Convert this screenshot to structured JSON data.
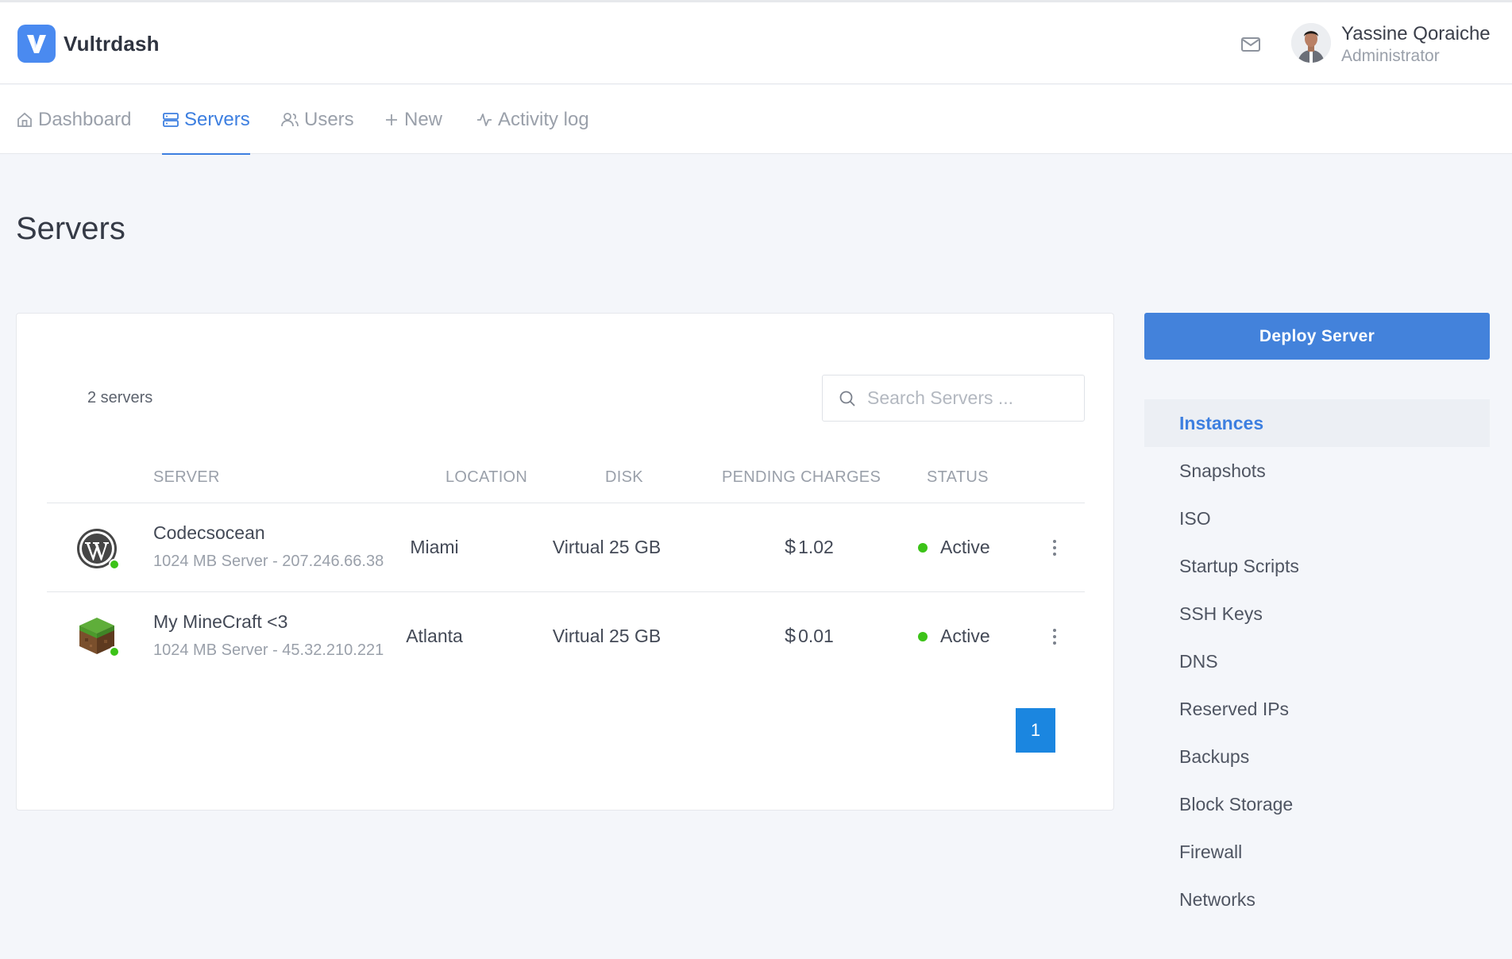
{
  "app": {
    "name": "Vultrdash"
  },
  "user": {
    "name": "Yassine Qoraiche",
    "role": "Administrator"
  },
  "nav": [
    {
      "label": "Dashboard",
      "icon": "home-icon",
      "active": false
    },
    {
      "label": "Servers",
      "icon": "server-icon",
      "active": true
    },
    {
      "label": "Users",
      "icon": "users-icon",
      "active": false
    },
    {
      "label": "New",
      "icon": "plus-icon",
      "active": false
    },
    {
      "label": "Activity log",
      "icon": "activity-icon",
      "active": false
    }
  ],
  "page": {
    "title": "Servers"
  },
  "servers": {
    "count_label": "2 servers",
    "search_placeholder": "Search Servers ...",
    "columns": [
      "SERVER",
      "LOCATION",
      "DISK",
      "PENDING CHARGES",
      "STATUS"
    ],
    "rows": [
      {
        "name": "Codecsocean",
        "details": "1024 MB Server - 207.246.66.38",
        "icon": "wordpress-icon",
        "location": "Miami",
        "disk": "Virtual 25 GB",
        "currency": "$",
        "charges": "1.02",
        "status": "Active"
      },
      {
        "name": "My MineCraft <3",
        "details": "1024 MB Server - 45.32.210.221",
        "icon": "minecraft-icon",
        "location": "Atlanta",
        "disk": "Virtual 25 GB",
        "currency": "$",
        "charges": "0.01",
        "status": "Active"
      }
    ],
    "pagination": {
      "current": "1"
    }
  },
  "sidebar": {
    "deploy_label": "Deploy Server",
    "items": [
      {
        "label": "Instances",
        "active": true
      },
      {
        "label": "Snapshots"
      },
      {
        "label": "ISO"
      },
      {
        "label": "Startup Scripts"
      },
      {
        "label": "SSH Keys"
      },
      {
        "label": "DNS"
      },
      {
        "label": "Reserved IPs"
      },
      {
        "label": "Backups"
      },
      {
        "label": "Block Storage"
      },
      {
        "label": "Firewall"
      },
      {
        "label": "Networks"
      }
    ]
  },
  "colors": {
    "accent": "#3d7fe0",
    "deploy": "#4382db",
    "status_active": "#3cc318",
    "pagination": "#1b86e0"
  }
}
